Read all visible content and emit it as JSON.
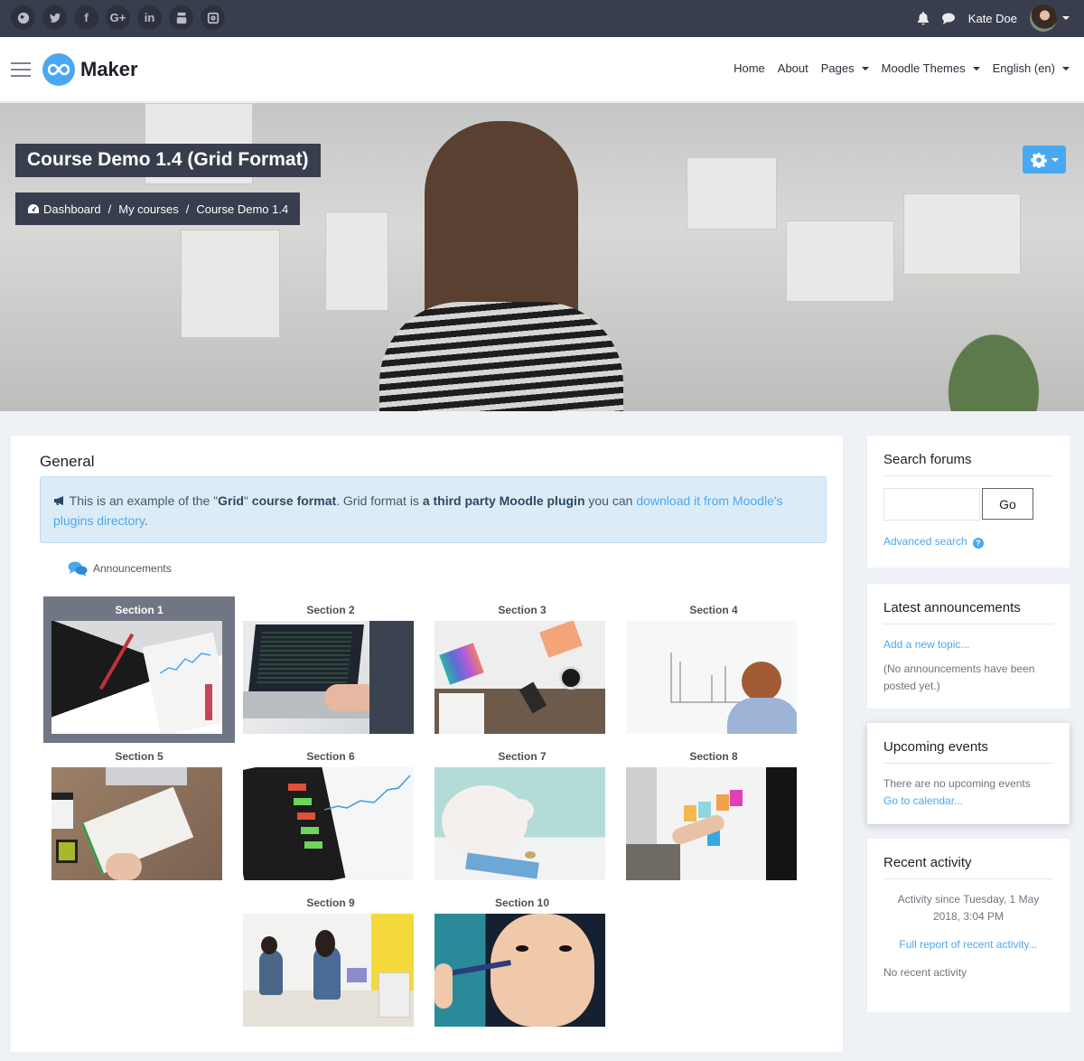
{
  "topbar": {
    "social": [
      {
        "name": "globe-icon",
        "glyph": ""
      },
      {
        "name": "twitter-icon",
        "glyph": ""
      },
      {
        "name": "facebook-icon",
        "glyph": "f"
      },
      {
        "name": "google-plus-icon",
        "glyph": "G+"
      },
      {
        "name": "linkedin-icon",
        "glyph": "in"
      },
      {
        "name": "youtube-icon",
        "glyph": ""
      },
      {
        "name": "instagram-icon",
        "glyph": ""
      }
    ],
    "user_name": "Kate Doe"
  },
  "navbar": {
    "brand": "Maker",
    "menu": [
      {
        "label": "Home",
        "dropdown": false
      },
      {
        "label": "About",
        "dropdown": false
      },
      {
        "label": "Pages",
        "dropdown": true
      },
      {
        "label": "Moodle Themes",
        "dropdown": true
      },
      {
        "label": "English (en)",
        "dropdown": true
      }
    ]
  },
  "header": {
    "title": "Course Demo 1.4 (Grid Format)",
    "breadcrumb": [
      "Dashboard",
      "My courses",
      "Course Demo 1.4"
    ],
    "breadcrumb_sep": "/"
  },
  "main": {
    "section_title": "General",
    "alert": {
      "t1": "This is an example of the \"",
      "b1": "Grid",
      "t2": "\" ",
      "b2": "course format",
      "t3": ". Grid format is ",
      "b3": "a third party Moodle plugin",
      "t4": " you can ",
      "link": "download it from Moodle's plugins directory",
      "t5": "."
    },
    "announcements_label": "Announcements",
    "sections": [
      {
        "label": "Section 1",
        "active": true,
        "image": "laptop-charts"
      },
      {
        "label": "Section 2",
        "active": false,
        "image": "laptop-code"
      },
      {
        "label": "Section 3",
        "active": false,
        "image": "design-desk"
      },
      {
        "label": "Section 4",
        "active": false,
        "image": "whiteboard-man"
      },
      {
        "label": "Section 5",
        "active": false,
        "image": "notebook-writing"
      },
      {
        "label": "Section 6",
        "active": false,
        "image": "stock-phone"
      },
      {
        "label": "Section 7",
        "active": false,
        "image": "piggy-bank"
      },
      {
        "label": "Section 8",
        "active": false,
        "image": "sticky-notes"
      },
      {
        "label": "Section 9",
        "active": false,
        "image": "office-desks"
      },
      {
        "label": "Section 10",
        "active": false,
        "image": "makeup-brush"
      }
    ]
  },
  "sidebar": {
    "search_forums": {
      "title": "Search forums",
      "input_value": "",
      "go_label": "Go",
      "advanced_label": "Advanced search"
    },
    "latest_announcements": {
      "title": "Latest announcements",
      "add_label": "Add a new topic...",
      "empty_text": "(No announcements have been posted yet.)"
    },
    "upcoming_events": {
      "title": "Upcoming events",
      "empty_text": "There are no upcoming events",
      "calendar_link": "Go to calendar..."
    },
    "recent_activity": {
      "title": "Recent activity",
      "since_text": "Activity since Tuesday, 1 May 2018, 3:04 PM",
      "report_link": "Full report of recent activity...",
      "empty_text": "No recent activity"
    }
  },
  "colors": {
    "accent": "#4aa8f2",
    "dark_bar": "#383e4d",
    "alert_bg": "#dcecf7",
    "active_tile": "#707683",
    "page_bg": "#eef1f6"
  }
}
